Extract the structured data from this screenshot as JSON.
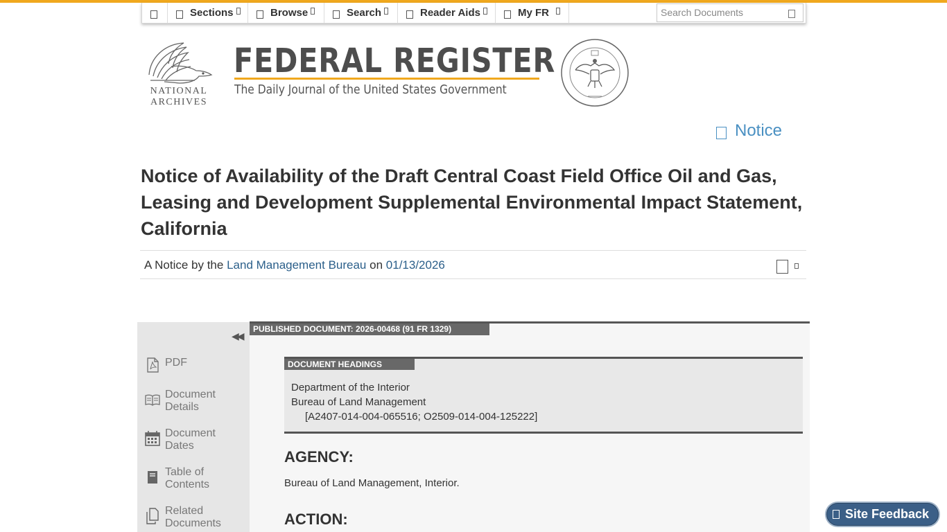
{
  "nav": {
    "items": [
      {
        "label": ""
      },
      {
        "label": "Sections"
      },
      {
        "label": "Browse"
      },
      {
        "label": "Search"
      },
      {
        "label": "Reader Aids"
      },
      {
        "label": "My FR"
      }
    ],
    "search_placeholder": "Search Documents"
  },
  "masthead": {
    "archives_line1": "NATIONAL",
    "archives_line2": "ARCHIVES",
    "title": "FEDERAL REGISTER",
    "subtitle": "The Daily Journal of the United States Government"
  },
  "document": {
    "type": "Notice",
    "title": "Notice of Availability of the Draft Central Coast Field Office Oil and Gas, Leasing and Development Supplemental Environmental Impact Statement, California",
    "byline_prefix": "A Notice by the",
    "agency_link": "Land Management Bureau",
    "byline_on": "on",
    "date_link": "01/13/2026",
    "published_label": "PUBLISHED DOCUMENT: 2026-00468 (91 FR 1329)",
    "headings_label": "DOCUMENT HEADINGS",
    "headings": [
      "Department of the Interior",
      "Bureau of Land Management",
      "[A2407-014-004-065516; O2509-014-004-125222]"
    ],
    "agency_heading": "AGENCY:",
    "agency_text": "Bureau of Land Management, Interior.",
    "action_heading": "ACTION:"
  },
  "sidebar": {
    "items": [
      {
        "line1": "PDF",
        "line2": ""
      },
      {
        "line1": "Document",
        "line2": "Details"
      },
      {
        "line1": "Document",
        "line2": "Dates"
      },
      {
        "line1": "Table of",
        "line2": "Contents"
      },
      {
        "line1": "Related",
        "line2": "Documents"
      }
    ]
  },
  "feedback": {
    "label": "Site Feedback"
  },
  "colors": {
    "accent": "#f0a81e",
    "link": "#2b5f8a",
    "doc_type": "#4a90c2"
  }
}
